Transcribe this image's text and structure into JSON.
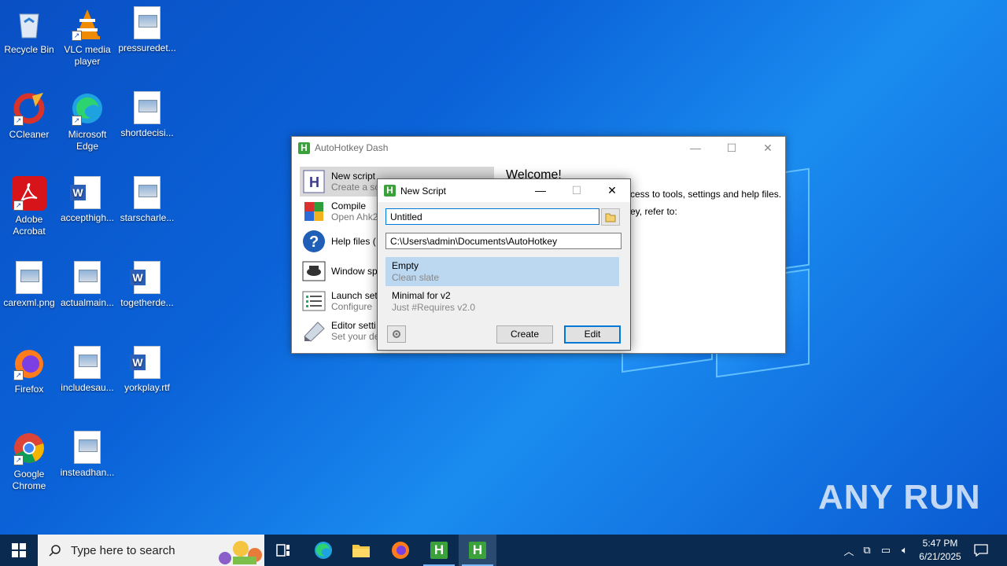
{
  "desktop": {
    "icons": [
      {
        "label": "Recycle Bin",
        "icon": "recycle-bin-icon"
      },
      {
        "label": "VLC media player",
        "icon": "vlc-icon"
      },
      {
        "label": "pressuredet...",
        "icon": "image-file-icon"
      },
      {
        "label": "CCleaner",
        "icon": "ccleaner-icon"
      },
      {
        "label": "Microsoft Edge",
        "icon": "edge-icon"
      },
      {
        "label": "shortdecisi...",
        "icon": "image-file-icon"
      },
      {
        "label": "Adobe Acrobat",
        "icon": "acrobat-icon"
      },
      {
        "label": "accepthigh...",
        "icon": "word-doc-icon"
      },
      {
        "label": "starscharle...",
        "icon": "image-file-icon"
      },
      {
        "label": "carexml.png",
        "icon": "image-file-icon"
      },
      {
        "label": "actualmain...",
        "icon": "image-file-icon"
      },
      {
        "label": "togetherde...",
        "icon": "word-doc-icon"
      },
      {
        "label": "Firefox",
        "icon": "firefox-icon"
      },
      {
        "label": "includesau...",
        "icon": "image-file-icon"
      },
      {
        "label": "yorkplay.rtf",
        "icon": "word-doc-icon"
      },
      {
        "label": "Google Chrome",
        "icon": "chrome-icon"
      },
      {
        "label": "insteadhan...",
        "icon": "image-file-icon"
      }
    ]
  },
  "dash": {
    "title": "AutoHotkey Dash",
    "items": [
      {
        "title": "New script",
        "sub": "Create a sc",
        "icon": "new-script-icon"
      },
      {
        "title": "Compile",
        "sub": "Open Ahk2",
        "icon": "compile-icon"
      },
      {
        "title": "Help files (",
        "sub": "",
        "icon": "help-icon"
      },
      {
        "title": "Window sp",
        "sub": "",
        "icon": "window-spy-icon"
      },
      {
        "title": "Launch set",
        "sub": "Configure",
        "icon": "launch-settings-icon"
      },
      {
        "title": "Editor setti",
        "sub": "Set your de",
        "icon": "editor-settings-icon"
      }
    ],
    "welcome": "Welcome!",
    "line1": "cess to tools, settings and help files.",
    "line2": "ey, refer to:"
  },
  "dialog": {
    "title": "New Script",
    "name_value": "Untitled",
    "path_value": "C:\\Users\\admin\\Documents\\AutoHotkey",
    "templates": [
      {
        "name": "Empty",
        "desc": "Clean slate"
      },
      {
        "name": "Minimal for v2",
        "desc": "Just #Requires v2.0"
      }
    ],
    "create_label": "Create",
    "edit_label": "Edit"
  },
  "taskbar": {
    "search_placeholder": "Type here to search",
    "time": "5:47 PM",
    "date": "6/21/2025"
  },
  "watermark": "ANY RUN"
}
